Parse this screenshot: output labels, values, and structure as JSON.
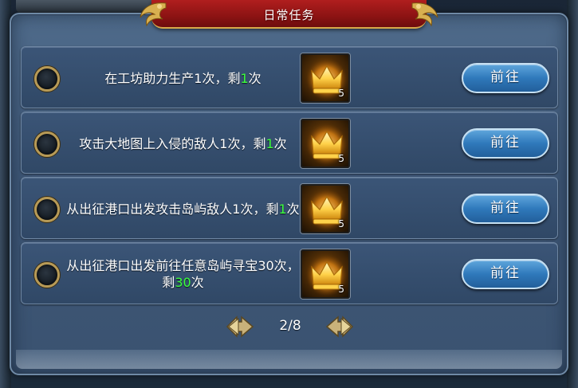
{
  "header": {
    "title": "日常任务"
  },
  "tasks": [
    {
      "desc_parts": [
        "在工坊助力生产1次，剩",
        "1",
        "次"
      ],
      "reward_qty": "5",
      "button_label": "前往"
    },
    {
      "desc_parts": [
        "攻击大地图上入侵的敌人1次，剩",
        "1",
        "次"
      ],
      "reward_qty": "5",
      "button_label": "前往"
    },
    {
      "desc_parts": [
        "从出征港口出发攻击岛屿敌人1次，剩",
        "1",
        "次"
      ],
      "reward_qty": "5",
      "button_label": "前往"
    },
    {
      "desc_parts": [
        "从出征港口出发前往任意岛屿寻宝30次，剩",
        "30",
        "次"
      ],
      "reward_qty": "5",
      "button_label": "前往"
    }
  ],
  "pagination": {
    "text": "2/8"
  },
  "icons": {
    "reward": "golden-crown-icon",
    "prev": "arrow-left-icon",
    "next": "arrow-right-icon",
    "radio": "empty-radio-icon"
  },
  "colors": {
    "highlight_number": "#3cff3c",
    "banner": "#a01818",
    "button": "#2f79bb"
  }
}
